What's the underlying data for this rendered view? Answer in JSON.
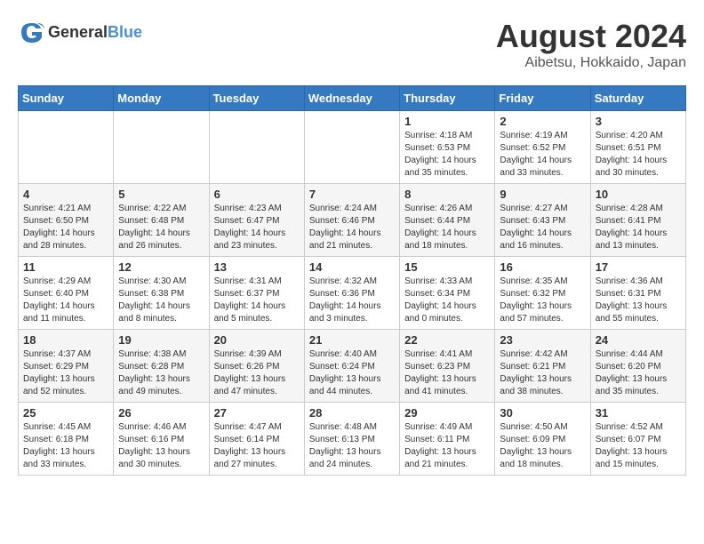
{
  "header": {
    "logo_general": "General",
    "logo_blue": "Blue",
    "month": "August 2024",
    "location": "Aibetsu, Hokkaido, Japan"
  },
  "weekdays": [
    "Sunday",
    "Monday",
    "Tuesday",
    "Wednesday",
    "Thursday",
    "Friday",
    "Saturday"
  ],
  "weeks": [
    [
      {
        "day": "",
        "info": ""
      },
      {
        "day": "",
        "info": ""
      },
      {
        "day": "",
        "info": ""
      },
      {
        "day": "",
        "info": ""
      },
      {
        "day": "1",
        "info": "Sunrise: 4:18 AM\nSunset: 6:53 PM\nDaylight: 14 hours\nand 35 minutes."
      },
      {
        "day": "2",
        "info": "Sunrise: 4:19 AM\nSunset: 6:52 PM\nDaylight: 14 hours\nand 33 minutes."
      },
      {
        "day": "3",
        "info": "Sunrise: 4:20 AM\nSunset: 6:51 PM\nDaylight: 14 hours\nand 30 minutes."
      }
    ],
    [
      {
        "day": "4",
        "info": "Sunrise: 4:21 AM\nSunset: 6:50 PM\nDaylight: 14 hours\nand 28 minutes."
      },
      {
        "day": "5",
        "info": "Sunrise: 4:22 AM\nSunset: 6:48 PM\nDaylight: 14 hours\nand 26 minutes."
      },
      {
        "day": "6",
        "info": "Sunrise: 4:23 AM\nSunset: 6:47 PM\nDaylight: 14 hours\nand 23 minutes."
      },
      {
        "day": "7",
        "info": "Sunrise: 4:24 AM\nSunset: 6:46 PM\nDaylight: 14 hours\nand 21 minutes."
      },
      {
        "day": "8",
        "info": "Sunrise: 4:26 AM\nSunset: 6:44 PM\nDaylight: 14 hours\nand 18 minutes."
      },
      {
        "day": "9",
        "info": "Sunrise: 4:27 AM\nSunset: 6:43 PM\nDaylight: 14 hours\nand 16 minutes."
      },
      {
        "day": "10",
        "info": "Sunrise: 4:28 AM\nSunset: 6:41 PM\nDaylight: 14 hours\nand 13 minutes."
      }
    ],
    [
      {
        "day": "11",
        "info": "Sunrise: 4:29 AM\nSunset: 6:40 PM\nDaylight: 14 hours\nand 11 minutes."
      },
      {
        "day": "12",
        "info": "Sunrise: 4:30 AM\nSunset: 6:38 PM\nDaylight: 14 hours\nand 8 minutes."
      },
      {
        "day": "13",
        "info": "Sunrise: 4:31 AM\nSunset: 6:37 PM\nDaylight: 14 hours\nand 5 minutes."
      },
      {
        "day": "14",
        "info": "Sunrise: 4:32 AM\nSunset: 6:36 PM\nDaylight: 14 hours\nand 3 minutes."
      },
      {
        "day": "15",
        "info": "Sunrise: 4:33 AM\nSunset: 6:34 PM\nDaylight: 14 hours\nand 0 minutes."
      },
      {
        "day": "16",
        "info": "Sunrise: 4:35 AM\nSunset: 6:32 PM\nDaylight: 13 hours\nand 57 minutes."
      },
      {
        "day": "17",
        "info": "Sunrise: 4:36 AM\nSunset: 6:31 PM\nDaylight: 13 hours\nand 55 minutes."
      }
    ],
    [
      {
        "day": "18",
        "info": "Sunrise: 4:37 AM\nSunset: 6:29 PM\nDaylight: 13 hours\nand 52 minutes."
      },
      {
        "day": "19",
        "info": "Sunrise: 4:38 AM\nSunset: 6:28 PM\nDaylight: 13 hours\nand 49 minutes."
      },
      {
        "day": "20",
        "info": "Sunrise: 4:39 AM\nSunset: 6:26 PM\nDaylight: 13 hours\nand 47 minutes."
      },
      {
        "day": "21",
        "info": "Sunrise: 4:40 AM\nSunset: 6:24 PM\nDaylight: 13 hours\nand 44 minutes."
      },
      {
        "day": "22",
        "info": "Sunrise: 4:41 AM\nSunset: 6:23 PM\nDaylight: 13 hours\nand 41 minutes."
      },
      {
        "day": "23",
        "info": "Sunrise: 4:42 AM\nSunset: 6:21 PM\nDaylight: 13 hours\nand 38 minutes."
      },
      {
        "day": "24",
        "info": "Sunrise: 4:44 AM\nSunset: 6:20 PM\nDaylight: 13 hours\nand 35 minutes."
      }
    ],
    [
      {
        "day": "25",
        "info": "Sunrise: 4:45 AM\nSunset: 6:18 PM\nDaylight: 13 hours\nand 33 minutes."
      },
      {
        "day": "26",
        "info": "Sunrise: 4:46 AM\nSunset: 6:16 PM\nDaylight: 13 hours\nand 30 minutes."
      },
      {
        "day": "27",
        "info": "Sunrise: 4:47 AM\nSunset: 6:14 PM\nDaylight: 13 hours\nand 27 minutes."
      },
      {
        "day": "28",
        "info": "Sunrise: 4:48 AM\nSunset: 6:13 PM\nDaylight: 13 hours\nand 24 minutes."
      },
      {
        "day": "29",
        "info": "Sunrise: 4:49 AM\nSunset: 6:11 PM\nDaylight: 13 hours\nand 21 minutes."
      },
      {
        "day": "30",
        "info": "Sunrise: 4:50 AM\nSunset: 6:09 PM\nDaylight: 13 hours\nand 18 minutes."
      },
      {
        "day": "31",
        "info": "Sunrise: 4:52 AM\nSunset: 6:07 PM\nDaylight: 13 hours\nand 15 minutes."
      }
    ]
  ]
}
